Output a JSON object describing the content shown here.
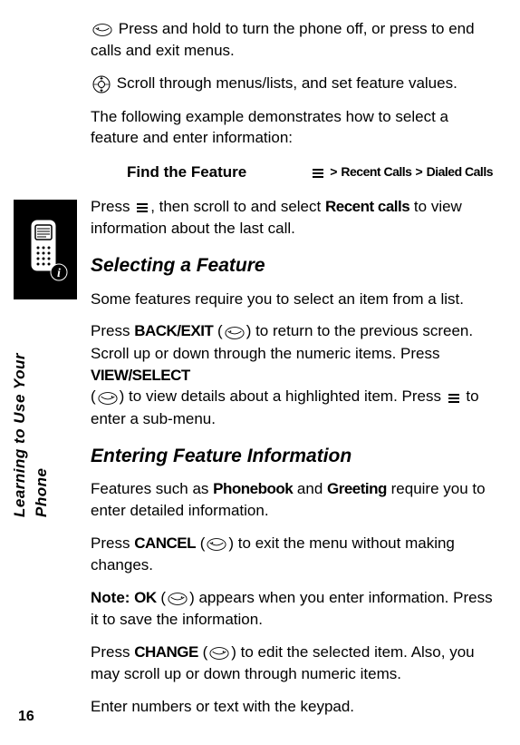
{
  "page_number": "16",
  "vertical_label": "Learning to Use Your Phone",
  "paragraphs": {
    "intro1": "Press and hold to turn the phone off, or press to end calls and exit menus.",
    "intro2": "Scroll through menus/lists, and set feature values.",
    "intro3": "The following example demonstrates how to select a feature and enter information:",
    "press_view": "Press ",
    "press_view_mid": ", then scroll to and select ",
    "press_view_end": " to view information about the last call.",
    "recent_calls": "Recent calls",
    "section1_title": "Selecting a Feature",
    "section1_text": "Some features require you to select an item from a list.",
    "back_exit_pre": "Press ",
    "back_exit": "BACK/EXIT",
    "back_exit_post": " (",
    "back_exit_after": ") to return to the previous screen. Scroll up or down through the numeric items. Press ",
    "view_select": "VIEW/SELECT",
    "view_select_post": "(",
    "view_select_after": ") to view details about a highlighted item. Press ",
    "view_select_end": " to enter a sub-menu.",
    "section2_title": "Entering Feature Information",
    "section2_text_pre": "Features such as ",
    "phonebook": "Phonebook",
    "section2_text_mid": " and ",
    "greeting": "Greeting",
    "section2_text_post": " require you to enter detailed information.",
    "cancel_pre": "Press ",
    "cancel": "CANCEL",
    "cancel_mid": " (",
    "cancel_post": ") to exit the menu without making changes.",
    "note_pre": "Note: ",
    "ok": "OK",
    "note_mid": " (",
    "note_post": ") appears when you enter information. Press it to save the information.",
    "change_pre": "Press ",
    "change": "CHANGE",
    "change_mid": " (",
    "change_post": ") to edit the selected item. Also, you may scroll up or down through numeric items.",
    "enter_text": "Enter numbers or text with the keypad."
  },
  "feature": {
    "label": "Find the Feature",
    "item1": "Recent Calls",
    "item2": "Dialed Calls"
  }
}
